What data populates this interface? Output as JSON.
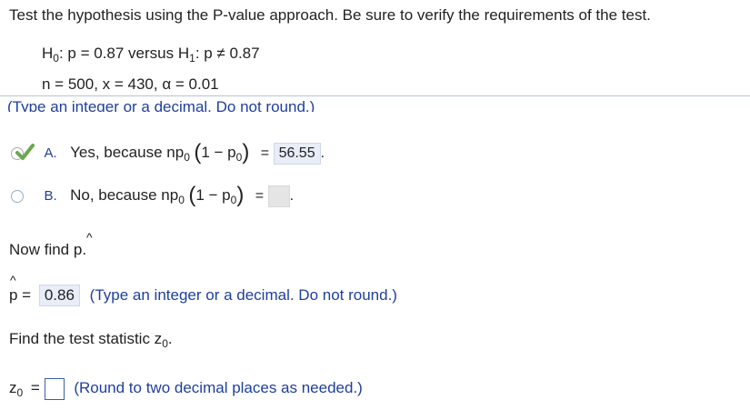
{
  "question": {
    "prompt": "Test the hypothesis using the P-value approach. Be sure to verify the requirements of the test.",
    "hyp_H": "H",
    "hyp_0": "0",
    "hyp_p1": ": p = 0.87 versus H",
    "hyp_1": "1",
    "hyp_p2": ": p ≠ 0.87",
    "given": "n = 500, x = 430, α = 0.01",
    "cut_hint": "(Type an integer or a decimal. Do not round.)"
  },
  "options": [
    {
      "letter": "A.",
      "text": "Yes, because np",
      "sub0": "0",
      "paren_open": "(",
      "mid": "1 − p",
      "sub1": "0",
      "paren_close": ")",
      "eq": "=",
      "value": "56.55",
      "tail": "."
    },
    {
      "letter": "B.",
      "text": "No, because np",
      "sub0": "0",
      "paren_open": "(",
      "mid": "1 − p",
      "sub1": "0",
      "paren_close": ")",
      "eq": "=",
      "value": "",
      "tail": "."
    }
  ],
  "phat_section": {
    "prompt": "Now find p.",
    "hat": "^",
    "answer_label": "p =",
    "answer": "0.86",
    "hint": "(Type an integer or a decimal. Do not round.)"
  },
  "z_section": {
    "prompt_pre": "Find the test statistic z",
    "prompt_sub": "0",
    "prompt_post": ".",
    "label": "z",
    "label_sub": "0",
    "eq": "=",
    "input_value": "",
    "hint": "(Round to two decimal places as needed.)"
  },
  "colors": {
    "link_blue": "#1f3f9e",
    "check_green": "#6aa84f",
    "answer_bg": "#e8edf7"
  }
}
